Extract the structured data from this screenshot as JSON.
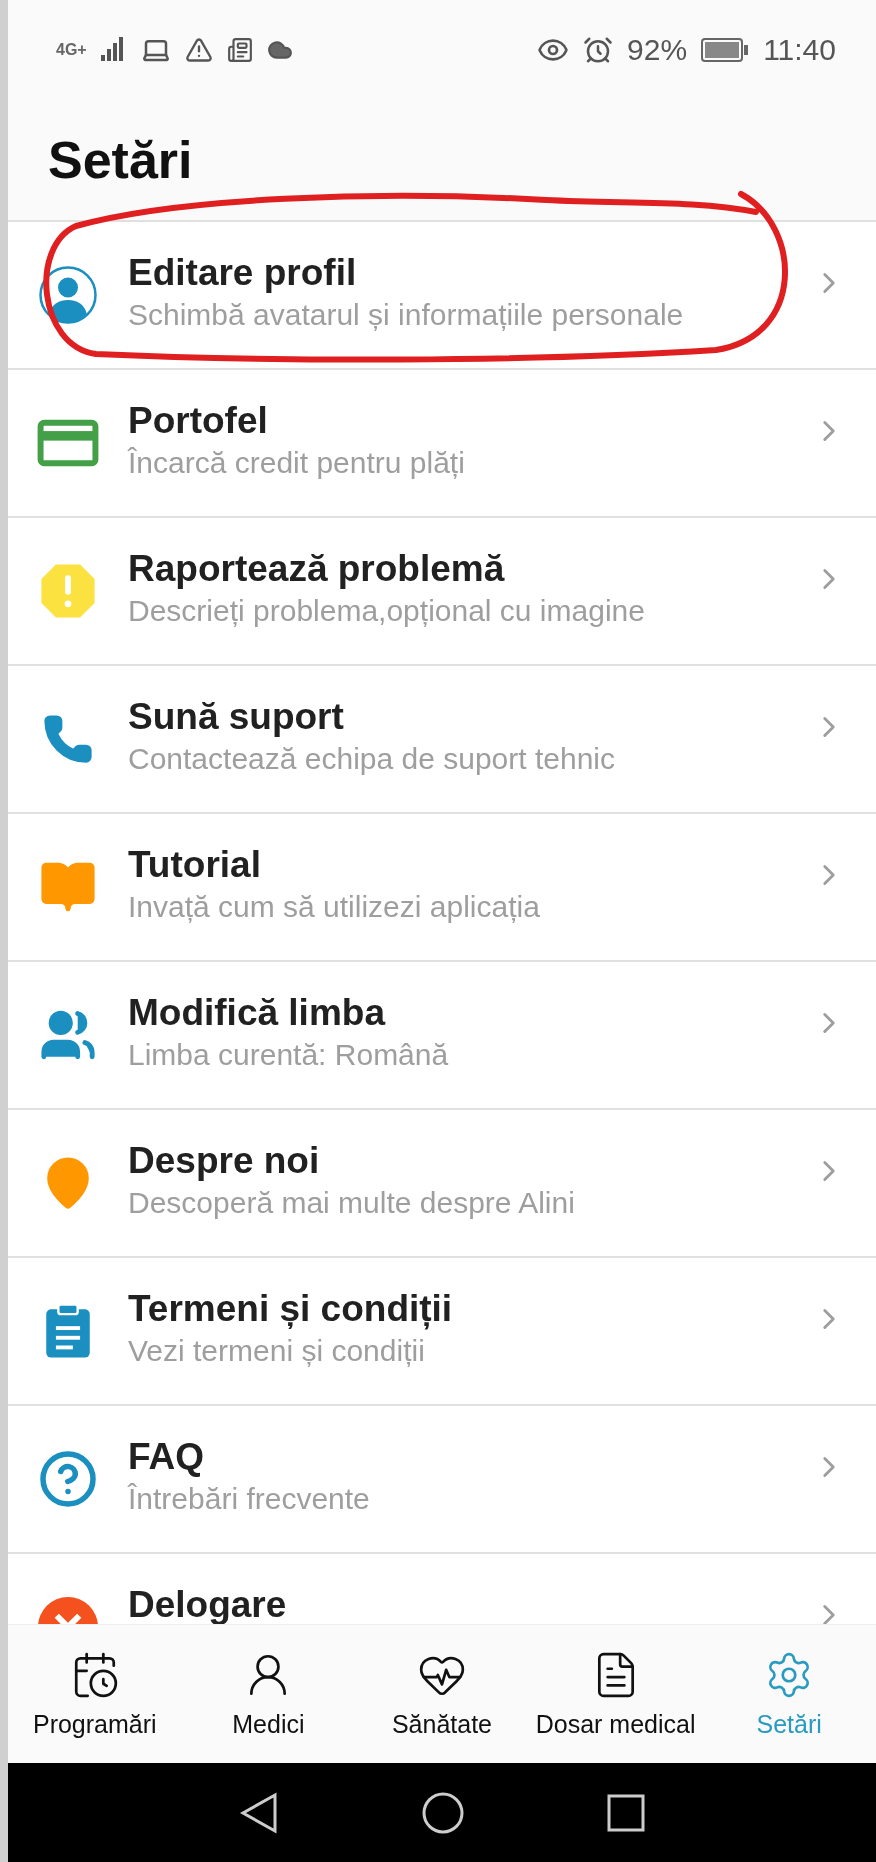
{
  "status_bar": {
    "network": "4G+",
    "battery": "92%",
    "time": "11:40"
  },
  "title": "Setări",
  "items": [
    {
      "kind": "avatar",
      "title": "Editare profil",
      "subtitle": "Schimbă avatarul și informațiile personale",
      "circled": true
    },
    {
      "kind": "card",
      "title": "Portofel",
      "subtitle": "Încarcă credit pentru plăți",
      "circled": false
    },
    {
      "kind": "warning",
      "title": "Raportează problemă",
      "subtitle": "Descrieți problema,opțional cu imagine",
      "circled": false
    },
    {
      "kind": "phone",
      "title": "Sună suport",
      "subtitle": "Contactează echipa de suport tehnic",
      "circled": false
    },
    {
      "kind": "book",
      "title": "Tutorial",
      "subtitle": "Invață cum să utilizezi aplicația",
      "circled": false
    },
    {
      "kind": "people",
      "title": "Modifică limba",
      "subtitle": "Limba curentă: Română",
      "circled": false
    },
    {
      "kind": "pin",
      "title": "Despre noi",
      "subtitle": "Descoperă mai multe despre Alini",
      "circled": false
    },
    {
      "kind": "clipboard",
      "title": "Termeni și condiții",
      "subtitle": "Vezi termeni și condiții",
      "circled": false
    },
    {
      "kind": "question",
      "title": "FAQ",
      "subtitle": "Întrebări frecvente",
      "circled": false
    },
    {
      "kind": "close",
      "title": "Delogare",
      "circled": false
    }
  ],
  "nav": [
    {
      "kind": "calendar",
      "label": "Programări",
      "selected": false
    },
    {
      "kind": "doctor",
      "label": "Medici",
      "selected": false
    },
    {
      "kind": "heart",
      "label": "Sănătate",
      "selected": false
    },
    {
      "kind": "folder",
      "label": "Dosar medical",
      "selected": false
    },
    {
      "kind": "gear",
      "label": "Setări",
      "selected": true
    }
  ]
}
